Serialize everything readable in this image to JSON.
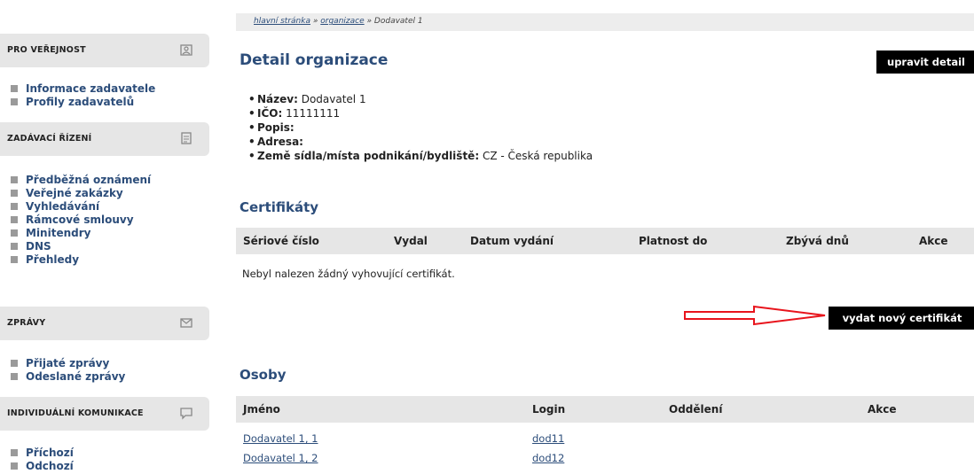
{
  "sidebar": {
    "sections": [
      {
        "title": "PRO VEŘEJNOST",
        "items": [
          "Informace zadavatele",
          "Profily zadavatelů"
        ]
      },
      {
        "title": "ZADÁVACÍ ŘÍZENÍ",
        "items": [
          "Předběžná oznámení",
          "Veřejné zakázky",
          "Vyhledávání",
          "Rámcové smlouvy",
          "Minitendry",
          "DNS",
          "Přehledy"
        ]
      },
      {
        "title": "ZPRÁVY",
        "items": [
          "Přijaté zprávy",
          "Odeslané zprávy"
        ]
      },
      {
        "title": "INDIVIDUÁLNÍ KOMUNIKACE",
        "items": [
          "Příchozí",
          "Odchozí"
        ]
      }
    ]
  },
  "breadcrumb": {
    "home": "hlavní stránka",
    "sep": " » ",
    "org": "organizace",
    "current": "Dodavatel 1"
  },
  "page": {
    "title": "Detail organizace",
    "edit_button": "upravit detail"
  },
  "details": {
    "name_label": "Název:",
    "name_value": " Dodavatel 1",
    "ico_label": "IČO:",
    "ico_value": " 11111111",
    "desc_label": "Popis:",
    "addr_label": "Adresa:",
    "country_label": "Země sídla/místa podnikání/bydliště:",
    "country_value": " CZ - Česká republika"
  },
  "certificates": {
    "title": "Certifikáty",
    "columns": [
      "Sériové číslo",
      "Vydal",
      "Datum vydání",
      "Platnost do",
      "Zbývá dnů",
      "Akce"
    ],
    "empty_message": "Nebyl nalezen žádný vyhovující certifikát.",
    "issue_button": "vydat nový certifikát",
    "arrow_color": "#e8141c"
  },
  "persons": {
    "title": "Osoby",
    "columns": [
      "Jméno",
      "Login",
      "Oddělení",
      "Akce"
    ],
    "rows": [
      {
        "name": "Dodavatel 1, 1",
        "login": "dod11",
        "department": "",
        "action": ""
      },
      {
        "name": "Dodavatel 1, 2",
        "login": "dod12",
        "department": "",
        "action": ""
      }
    ]
  },
  "colors": {
    "link": "#2c4d7a",
    "header_bg": "#e6e6e6",
    "button_bg": "#000000"
  }
}
